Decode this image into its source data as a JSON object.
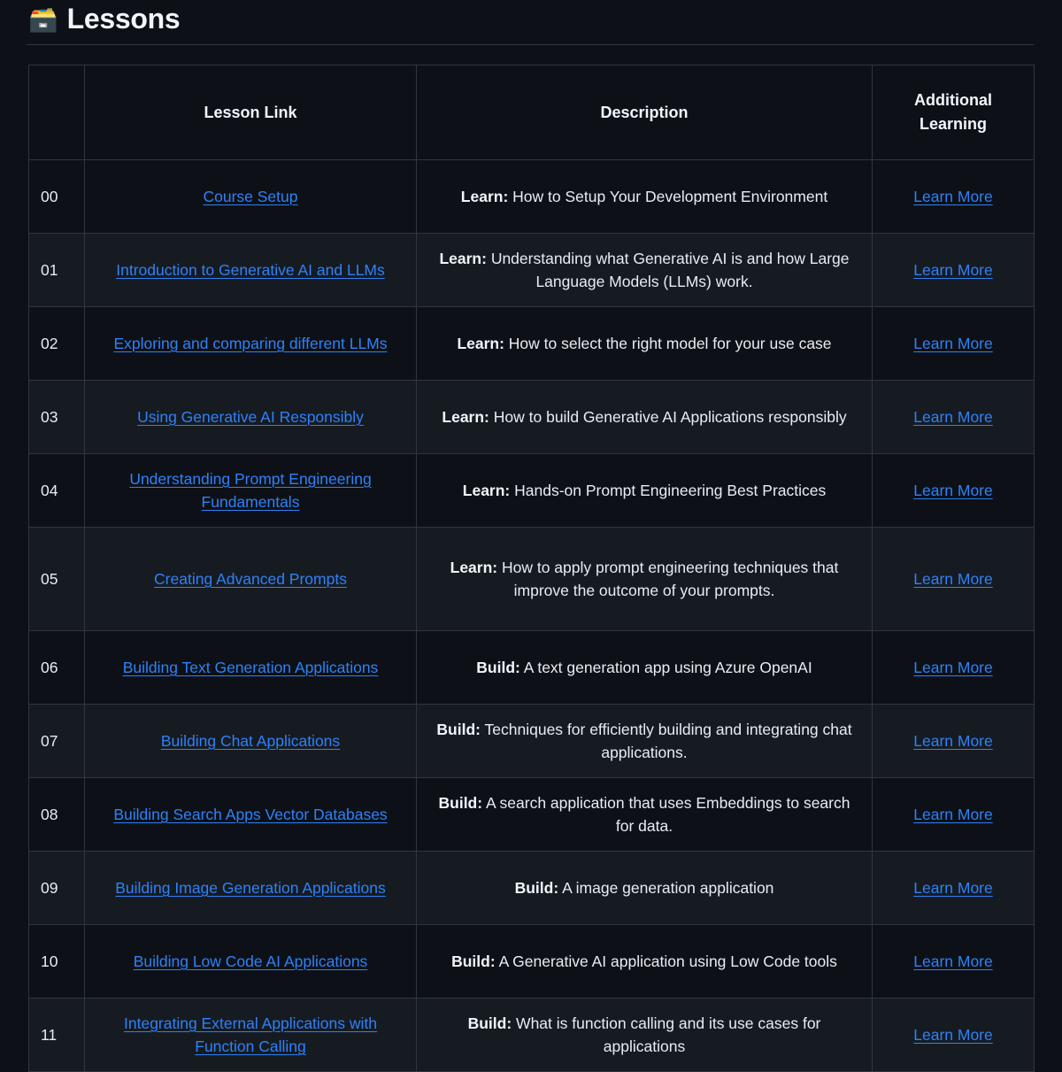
{
  "page": {
    "title": "Lessons",
    "title_icon": "card-file-box-icon",
    "title_emoji": "🗃️",
    "background_color": "#0d1117",
    "link_color": "#2f81f7",
    "border_color": "#30363d",
    "text_color": "#e6edf3",
    "row_alt_color": "#161b22"
  },
  "table": {
    "headers": {
      "num": "",
      "link": "Lesson Link",
      "description": "Description",
      "additional": "Additional Learning"
    },
    "rows": [
      {
        "num": "00",
        "link": "Course Setup",
        "desc_prefix": "Learn:",
        "desc_text": " How to Setup Your Development Environment",
        "extra": "Learn More",
        "tall": false
      },
      {
        "num": "01",
        "link": "Introduction to Generative AI and LLMs",
        "desc_prefix": "Learn:",
        "desc_text": " Understanding what Generative AI is and how Large Language Models (LLMs) work.",
        "extra": "Learn More",
        "tall": false
      },
      {
        "num": "02",
        "link": "Exploring and comparing different LLMs",
        "desc_prefix": "Learn:",
        "desc_text": " How to select the right model for your use case",
        "extra": "Learn More",
        "tall": false
      },
      {
        "num": "03",
        "link": "Using Generative AI Responsibly",
        "desc_prefix": "Learn:",
        "desc_text": " How to build Generative AI Applications responsibly",
        "extra": "Learn More",
        "tall": false
      },
      {
        "num": "04",
        "link": "Understanding Prompt Engineering Fundamentals",
        "desc_prefix": "Learn:",
        "desc_text": " Hands-on Prompt Engineering Best Practices",
        "extra": "Learn More",
        "tall": false
      },
      {
        "num": "05",
        "link": "Creating Advanced Prompts",
        "desc_prefix": "Learn:",
        "desc_text": " How to apply prompt engineering techniques that improve the outcome of your prompts.",
        "extra": "Learn More",
        "tall": true
      },
      {
        "num": "06",
        "link": "Building Text Generation Applications",
        "desc_prefix": "Build:",
        "desc_text": " A text generation app using Azure OpenAI",
        "extra": "Learn More",
        "tall": false
      },
      {
        "num": "07",
        "link": "Building Chat Applications",
        "desc_prefix": "Build:",
        "desc_text": " Techniques for efficiently building and integrating chat applications.",
        "extra": "Learn More",
        "tall": false
      },
      {
        "num": "08",
        "link": "Building Search Apps Vector Databases",
        "desc_prefix": "Build:",
        "desc_text": " A search application that uses Embeddings to search for data.",
        "extra": "Learn More",
        "tall": false
      },
      {
        "num": "09",
        "link": "Building Image Generation Applications",
        "desc_prefix": "Build:",
        "desc_text": " A image generation application",
        "extra": "Learn More",
        "tall": false
      },
      {
        "num": "10",
        "link": "Building Low Code AI Applications",
        "desc_prefix": "Build:",
        "desc_text": " A Generative AI application using Low Code tools",
        "extra": "Learn More",
        "tall": false
      },
      {
        "num": "11",
        "link": "Integrating External Applications with Function Calling",
        "desc_prefix": "Build:",
        "desc_text": " What is function calling and its use cases for applications",
        "extra": "Learn More",
        "tall": false
      }
    ]
  }
}
